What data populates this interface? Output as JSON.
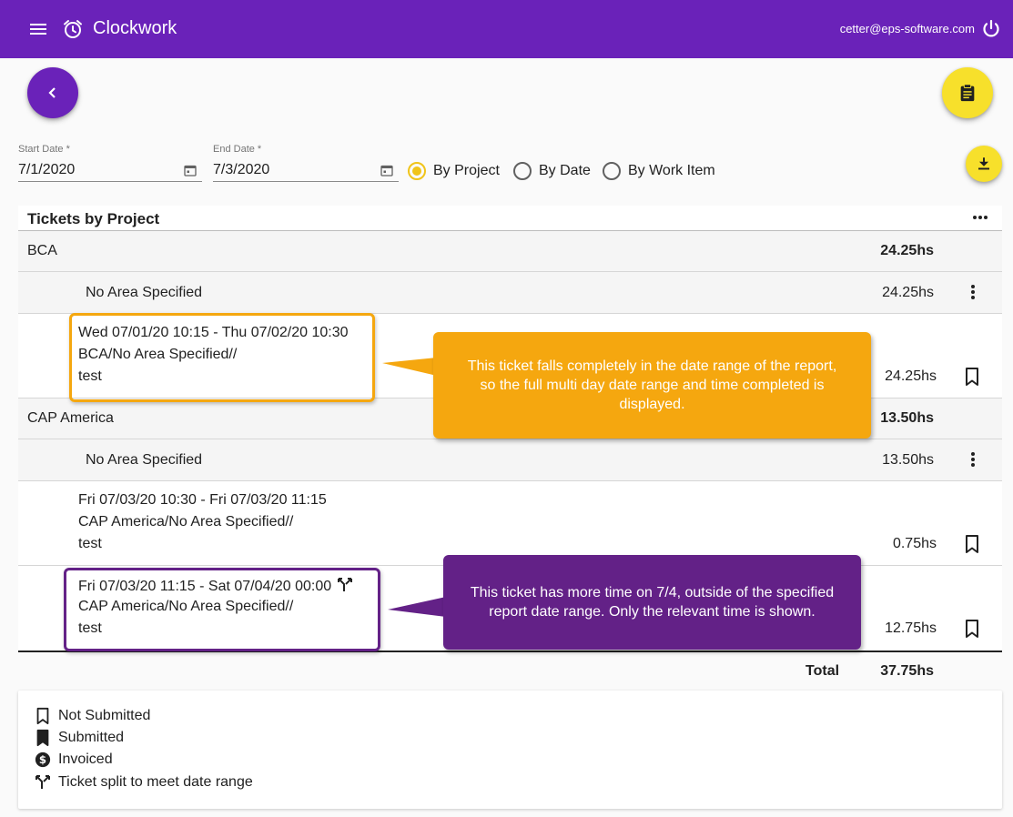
{
  "app": {
    "title": "Clockwork",
    "user_email": "cetter@eps-software.com",
    "accent_color": "#6a22b9",
    "fab_color": "#f7e02b"
  },
  "filters": {
    "start_label": "Start Date *",
    "start_value": "7/1/2020",
    "end_label": "End Date *",
    "end_value": "7/3/2020",
    "group_options": [
      {
        "label": "By Project",
        "selected": true
      },
      {
        "label": "By Date",
        "selected": false
      },
      {
        "label": "By Work Item",
        "selected": false
      }
    ]
  },
  "report": {
    "title": "Tickets by Project",
    "projects": [
      {
        "name": "BCA",
        "hours": "24.25hs",
        "area": {
          "name": "No Area Specified",
          "hours": "24.25hs"
        },
        "tickets": [
          {
            "range": "Wed 07/01/20 10:15 - Thu 07/02/20 10:30",
            "path": "BCA/No Area Specified//",
            "desc": "test",
            "hours": "24.25hs",
            "split": false
          }
        ]
      },
      {
        "name": "CAP America",
        "hours": "13.50hs",
        "area": {
          "name": "No Area Specified",
          "hours": "13.50hs"
        },
        "tickets": [
          {
            "range": "Fri 07/03/20 10:30 - Fri 07/03/20 11:15",
            "path": "CAP America/No Area Specified//",
            "desc": "test",
            "hours": "0.75hs",
            "split": false
          },
          {
            "range": "Fri 07/03/20 11:15 - Sat 07/04/20 00:00",
            "path": "CAP America/No Area Specified//",
            "desc": "test",
            "hours": "12.75hs",
            "split": true
          }
        ]
      }
    ],
    "total_label": "Total",
    "total_value": "37.75hs"
  },
  "legend": {
    "not_submitted": "Not Submitted",
    "submitted": "Submitted",
    "invoiced": "Invoiced",
    "split": "Ticket split to meet date range"
  },
  "callouts": {
    "orange_text": "This ticket falls completely in the date range of the report, so the full multi day date range and time completed is displayed.",
    "purple_text": "This ticket has more time on 7/4, outside of the specified report date range. Only the relevant time is shown.",
    "orange_color": "#f5a70f",
    "purple_color": "#632187"
  },
  "icons": [
    "menu-icon",
    "alarm-icon",
    "power-icon",
    "chevron-left-icon",
    "clipboard-icon",
    "download-icon",
    "calendar-icon",
    "more-horizontal-icon",
    "more-vertical-icon",
    "bookmark-outline-icon",
    "bookmark-filled-icon",
    "dollar-circle-icon",
    "split-icon"
  ]
}
